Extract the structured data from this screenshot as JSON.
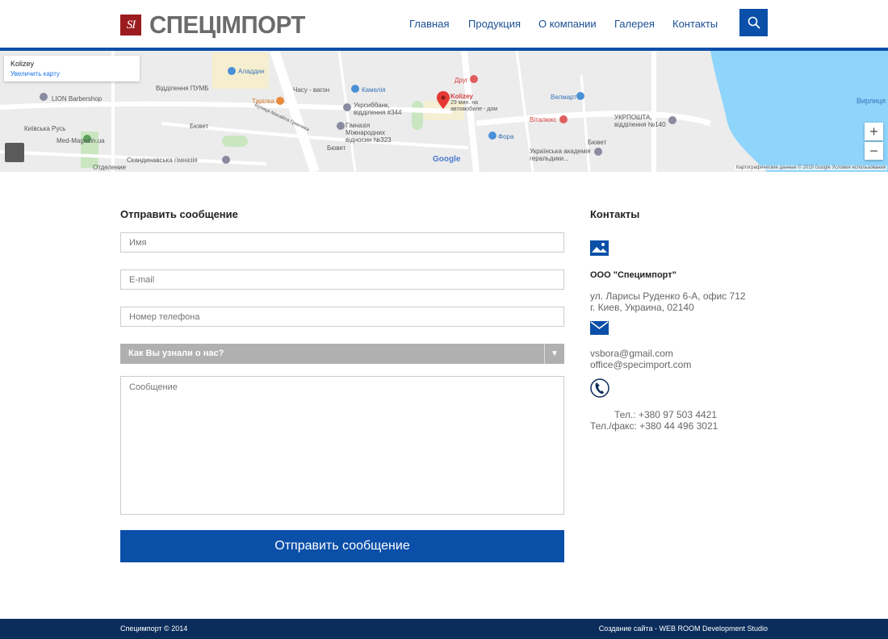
{
  "header": {
    "logo_mark": "SI",
    "logo_text": "СПЕЦІМПОРТ",
    "nav": [
      {
        "label": "Главная"
      },
      {
        "label": "Продукция"
      },
      {
        "label": "О компании"
      },
      {
        "label": "Галерея"
      },
      {
        "label": "Контакты"
      }
    ],
    "search_icon": "search-icon"
  },
  "map": {
    "info_title": "Kolizey",
    "info_link": "Увеличить карту",
    "labels": {
      "barbershop": "LION Barbershop",
      "kyivska_rus": "Київська Русь",
      "med_magazin": "Med-Magazin.ua",
      "otdelenie": "Отделение",
      "puma": "Відділення ПУМБ",
      "aladdin": "Аладдин",
      "tarilka": "Тарілка",
      "chasu_vagon": "Часу - вагон",
      "kamelia": "Камелія",
      "ukrsib": "Укрсиббанк, відділення #344",
      "gymnasium": "Гімназія Міжнародних відносин №323",
      "kolizey": "Kolizey",
      "kolizey_sub": "29 мин. на автомобиле - дом",
      "drug": "Друг",
      "velmart": "Велмарт",
      "vitalyux": "Віталюкс",
      "fora": "Фора",
      "ukrposhta": "УКРПОШТА, відділення №140",
      "academy": "Українська академія геральдики...",
      "buvet1": "Бювет",
      "buvet2": "Бювет",
      "buvet3": "Бювет",
      "scandi": "Скандинавська гімназія",
      "virlitsa": "Вирлиця",
      "grinchenka": "Вулиця Михайла Гринчика"
    },
    "google": "Google",
    "attribution": "Картографические данные © 2019 Google   Условия использования",
    "zoom_in": "+",
    "zoom_out": "−"
  },
  "form": {
    "title": "Отправить сообщение",
    "name_placeholder": "Имя",
    "email_placeholder": "E-mail",
    "phone_placeholder": "Номер телефона",
    "source_select": "Как Вы узнали о нас?",
    "message_placeholder": "Сообщение",
    "submit_label": "Отправить сообщение"
  },
  "contacts": {
    "title": "Контакты",
    "company": "ООО \"Специмпорт\"",
    "address_line1": "ул. Ларисы Руденко 6-А, офис 712",
    "address_line2": "г. Киев, Украина, 02140",
    "email1": "vsbora@gmail.com",
    "email2": "office@specimport.com",
    "phone1": "Тел.: +380 97 503 4421",
    "phone2": "Тел./факс: +380 44 496 3021"
  },
  "footer": {
    "copyright": "Специмпорт © 2014",
    "credits": "Создание сайта - WEB ROOM Development Studio"
  },
  "colors": {
    "brand_blue": "#0a4fa8",
    "footer_navy": "#0b2d5c",
    "logo_red": "#9b1b1e"
  }
}
